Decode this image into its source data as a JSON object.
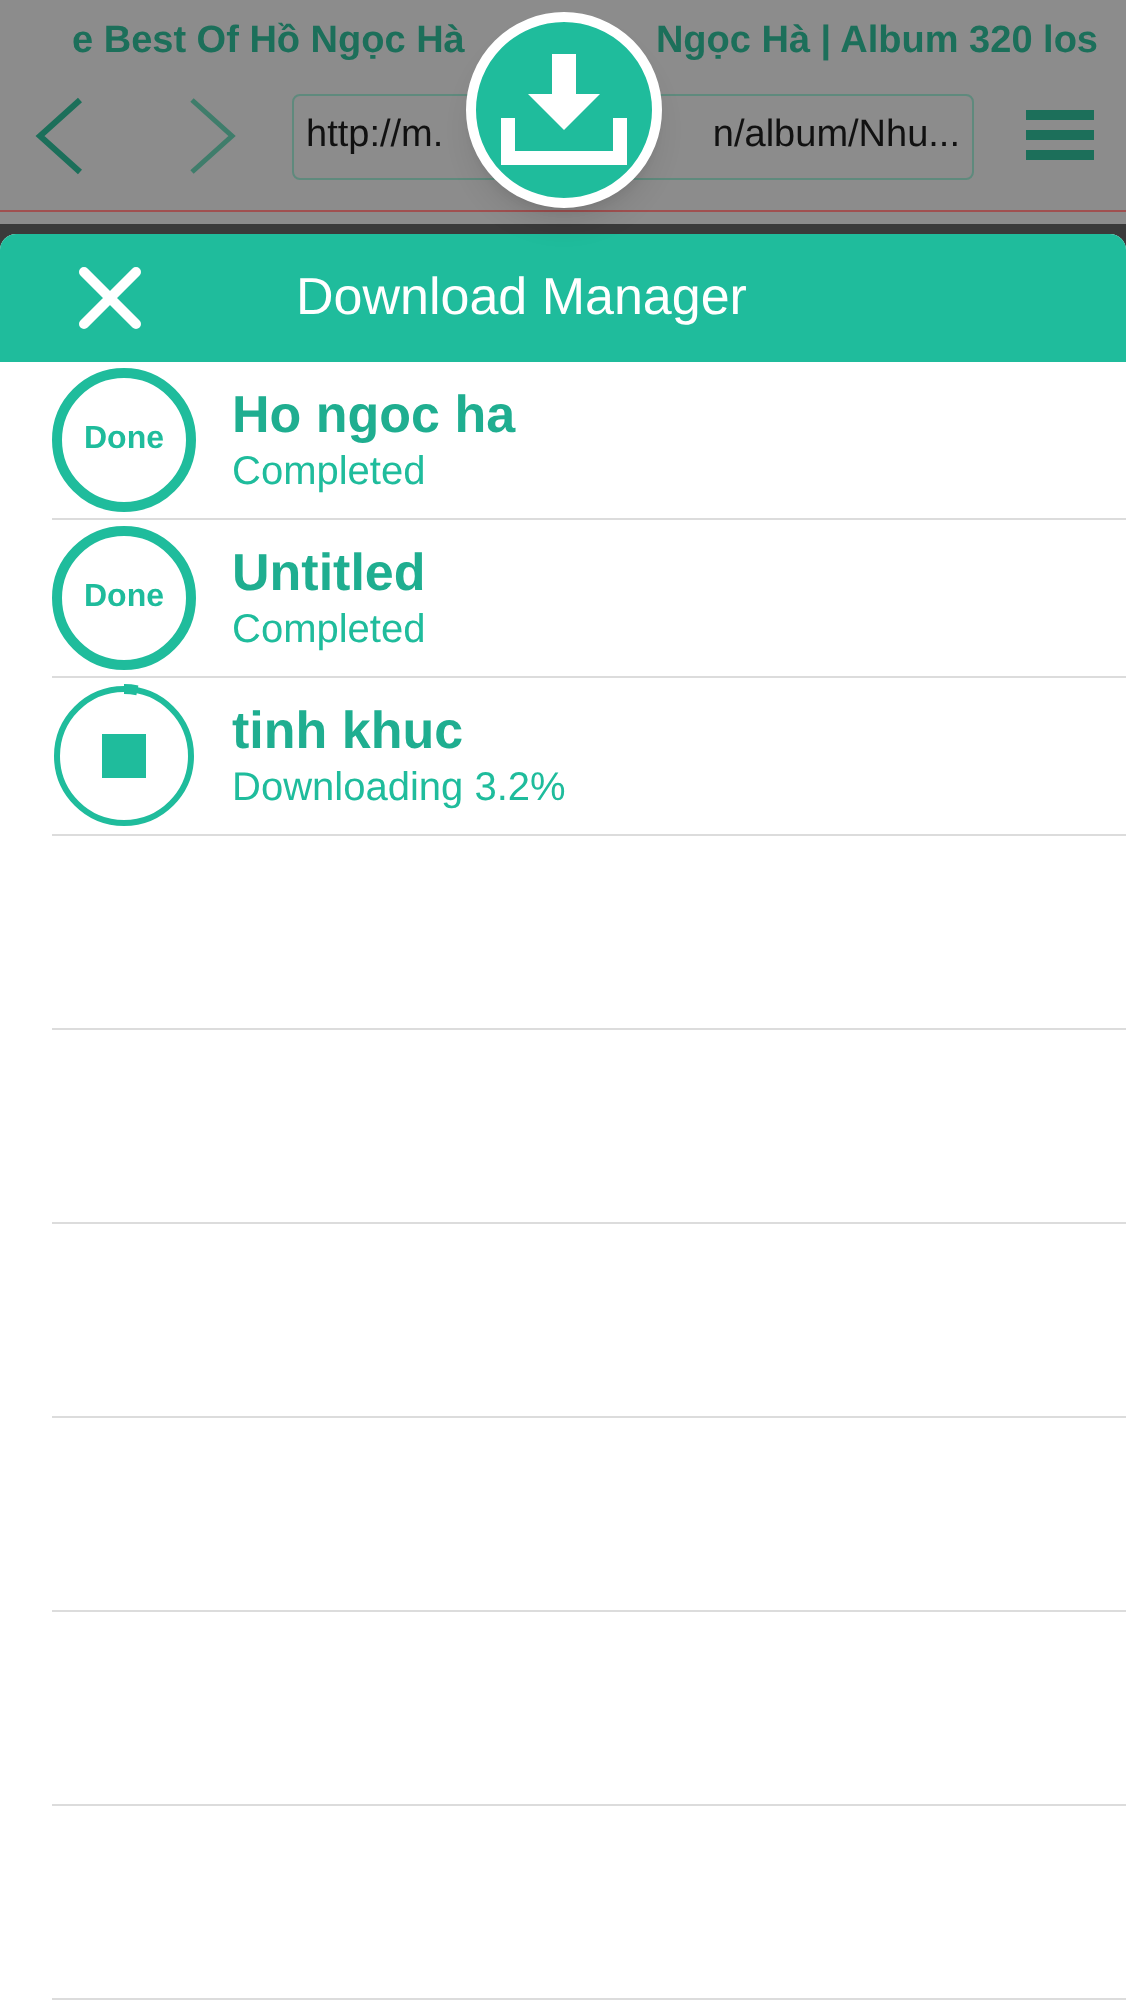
{
  "browser": {
    "title_left": "e Best Of Hồ Ngọc Hà",
    "title_right": "Ngọc Hà | Album 320 los",
    "url_left": "http://m.",
    "url_right": "n/album/Nhu..."
  },
  "download_manager": {
    "title": "Download Manager",
    "items": [
      {
        "kind": "done",
        "badge": "Done",
        "name": "Ho ngoc ha",
        "status": "Completed"
      },
      {
        "kind": "done",
        "badge": "Done",
        "name": "Untitled",
        "status": "Completed"
      },
      {
        "kind": "downloading",
        "name": "tinh khuc",
        "status": "Downloading 3.2%",
        "level": 0.032
      }
    ]
  }
}
